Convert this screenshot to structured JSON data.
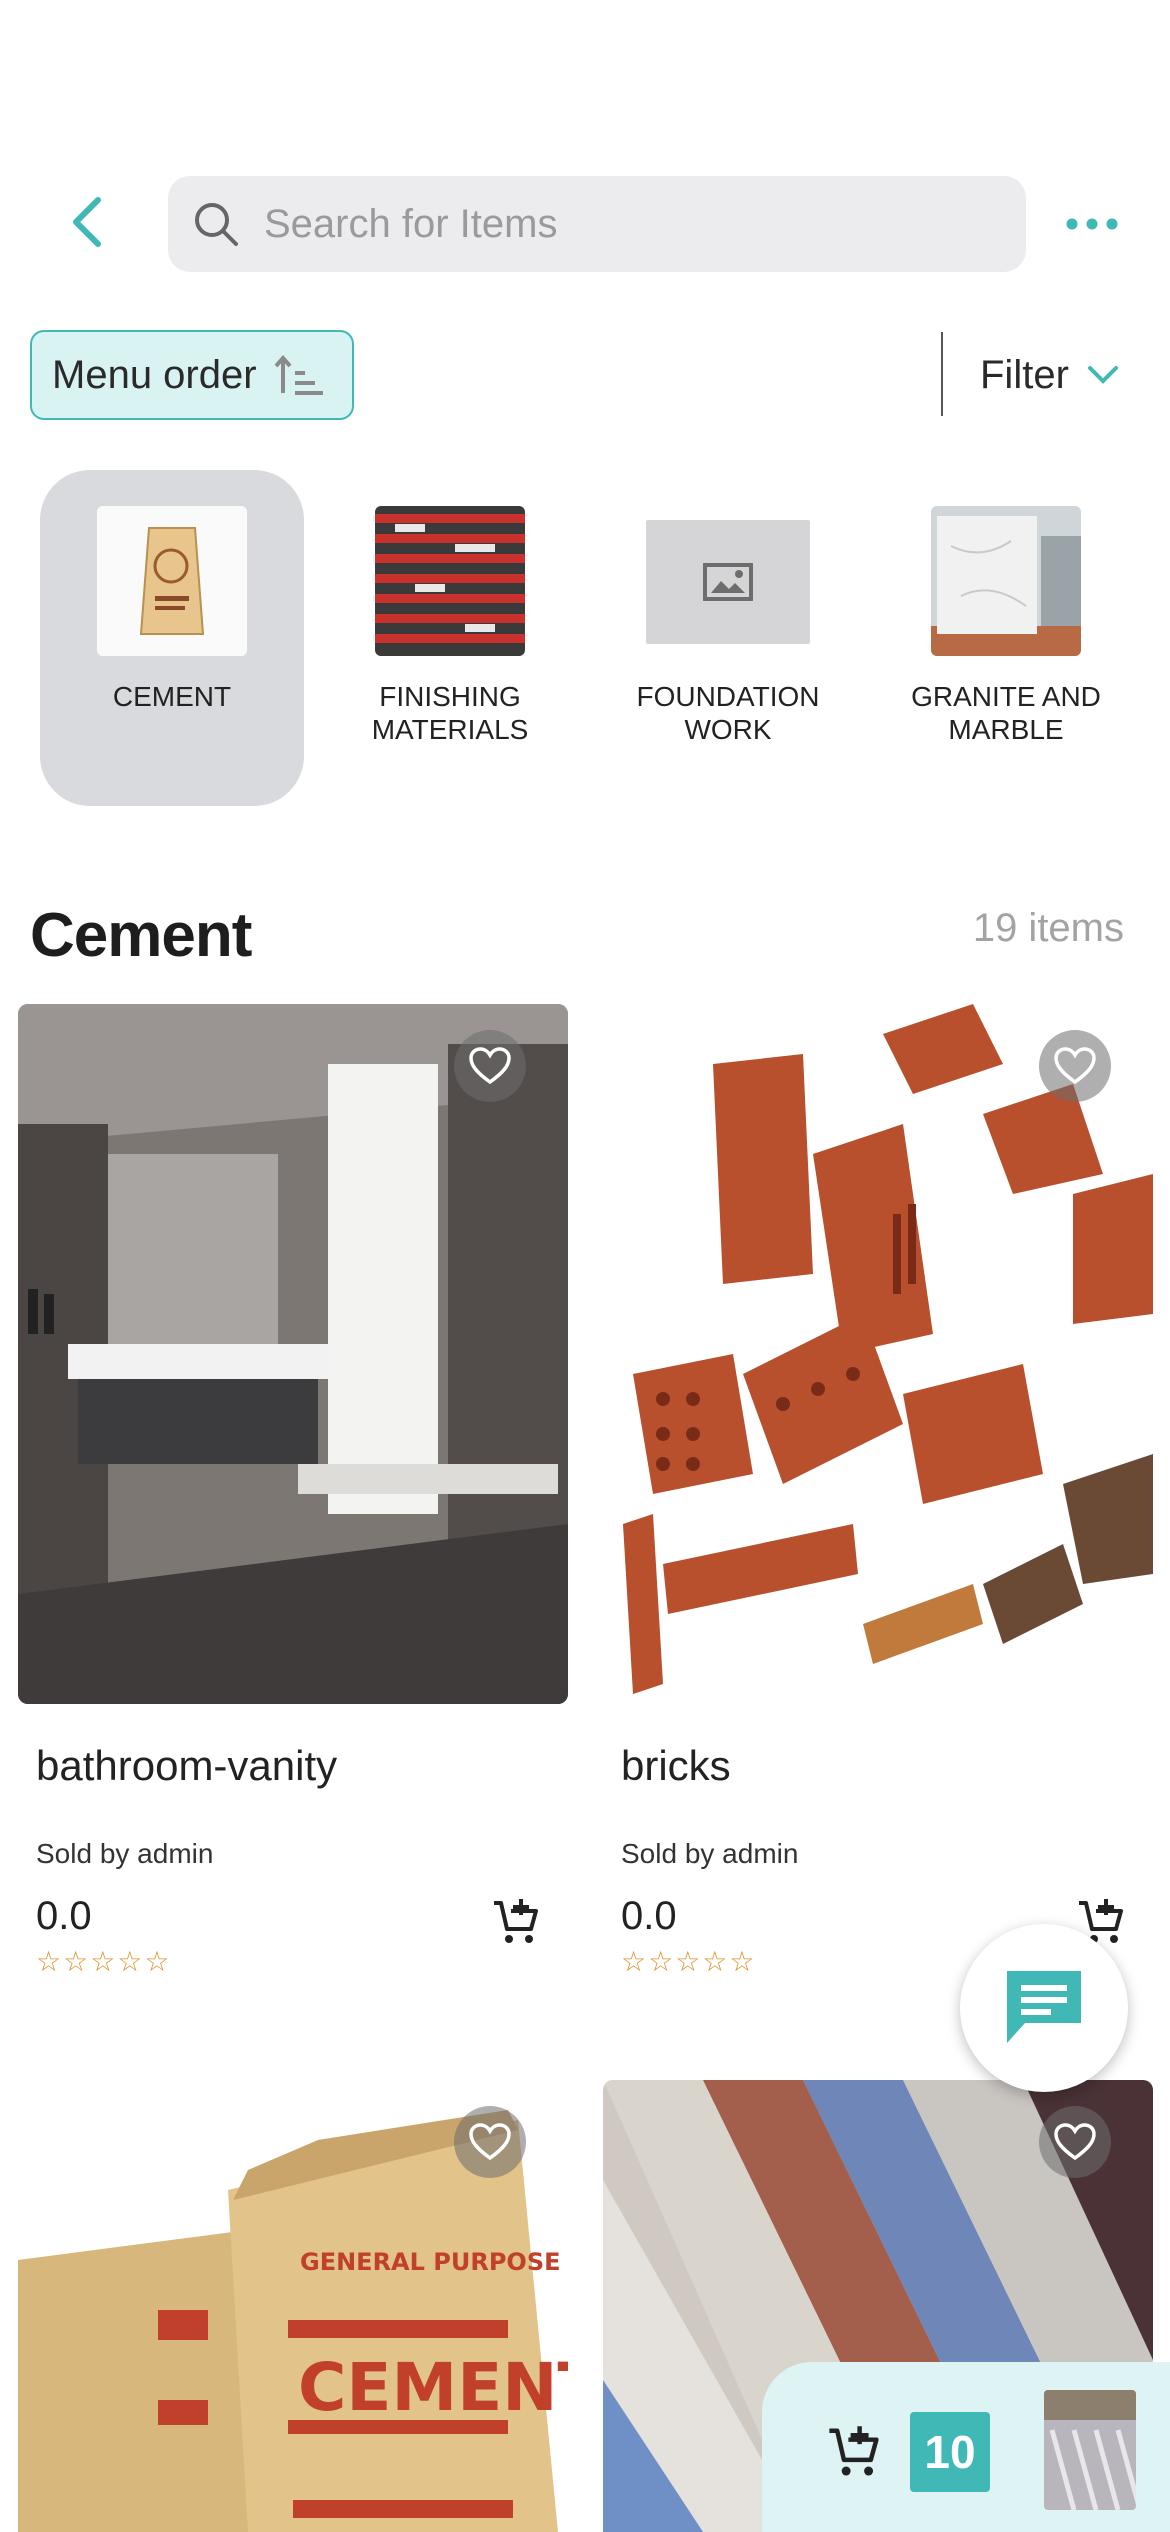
{
  "search": {
    "placeholder": "Search for Items"
  },
  "toolbar": {
    "sort_label": "Menu order",
    "filter_label": "Filter"
  },
  "categories": [
    {
      "label": "CEMENT",
      "active": true
    },
    {
      "label": "FINISHING MATERIALS",
      "active": false
    },
    {
      "label": "FOUNDATION WORK",
      "active": false
    },
    {
      "label": "GRANITE AND MARBLE",
      "active": false
    }
  ],
  "section": {
    "title": "Cement",
    "count": "19 items"
  },
  "products": [
    {
      "name": "bathroom-vanity",
      "seller": "Sold by admin",
      "price": "0.0",
      "rating": 0,
      "stars": "☆☆☆☆☆"
    },
    {
      "name": "bricks",
      "seller": "Sold by admin",
      "price": "0.0",
      "rating": 0,
      "stars": "☆☆☆☆☆"
    },
    {
      "image_text_top": "GENERAL PURPOSE",
      "image_text_main": "CEMENT"
    },
    {}
  ],
  "cart": {
    "count": "10"
  },
  "colors": {
    "accent": "#3fb8b6",
    "accent_light": "#d9f3f3",
    "star": "#e0912c"
  }
}
